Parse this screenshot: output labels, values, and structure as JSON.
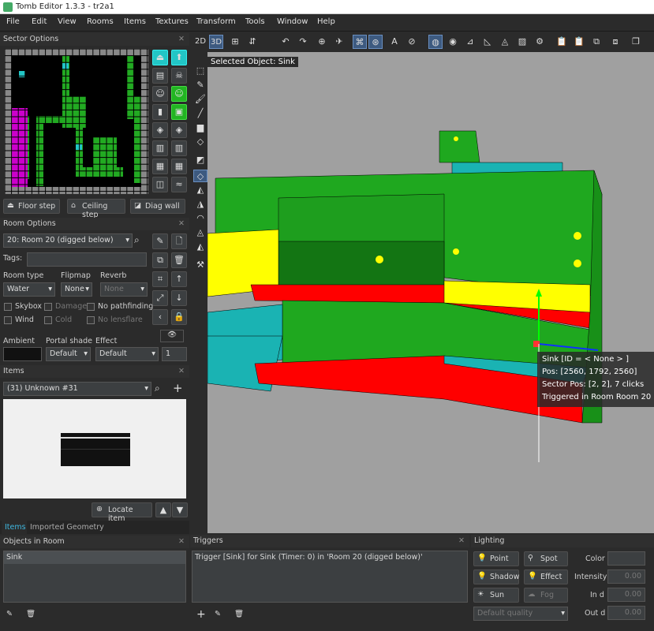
{
  "window": {
    "title": "Tomb Editor 1.3.3 - tr2a1"
  },
  "menu": [
    "File",
    "Edit",
    "View",
    "Rooms",
    "Items",
    "Textures",
    "Transform",
    "Tools",
    "Window",
    "Help"
  ],
  "sector": {
    "title": "Sector Options",
    "floor_step": "Floor step",
    "ceiling_step": "Ceiling step",
    "diag_wall": "Diag wall"
  },
  "room": {
    "title": "Room Options",
    "selected": "20: Room 20 (digged below)",
    "tags_label": "Tags:",
    "type_label": "Room type",
    "type_value": "Water",
    "flipmap_label": "Flipmap",
    "flipmap_value": "None",
    "reverb_label": "Reverb",
    "reverb_value": "None",
    "skybox": "Skybox",
    "damage": "Damage",
    "no_pathfinding": "No pathfinding",
    "wind": "Wind",
    "cold": "Cold",
    "no_lensflare": "No lensflare",
    "ambient_label": "Ambient",
    "portal_shade_label": "Portal shade",
    "portal_shade_value": "Default",
    "effect_label": "Effect",
    "effect_value": "Default",
    "effect_num": "1"
  },
  "items": {
    "title": "Items",
    "selected": "(31) Unknown #31",
    "locate": "Locate item",
    "tab_items": "Items",
    "tab_geometry": "Imported Geometry"
  },
  "objects": {
    "title": "Objects in Room",
    "list": [
      "Sink"
    ]
  },
  "triggers": {
    "title": "Triggers",
    "list": [
      "Trigger [Sink] for Sink (Timer: 0) in 'Room 20 (digged below)'"
    ]
  },
  "lighting": {
    "title": "Lighting",
    "point": "Point",
    "spot": "Spot",
    "shadow": "Shadow",
    "effect": "Effect",
    "sun": "Sun",
    "fog": "Fog",
    "color_label": "Color",
    "intensity_label": "Intensity",
    "intensity_value": "0.00",
    "in_label": "In d",
    "in_value": "0.00",
    "out_label": "Out d",
    "out_value": "0.00",
    "quality": "Default quality"
  },
  "viewport": {
    "mode_2d": "2D",
    "mode_3d": "3D",
    "selected_label": "Selected Object: Sink",
    "tip_line1": "Sink [ID = < None > ]",
    "tip_line2": "Pos: [2560, 1792, 2560]",
    "tip_line3": "Sector Pos: [2, 2], 7 clicks",
    "tip_line4": "Triggered in Room Room 20"
  },
  "colors": {
    "green": "#1fa81f",
    "red": "#ff0000",
    "yellow": "#ffff00",
    "cyan": "#1ab3b3",
    "magenta": "#cc00cc",
    "bg": "#a0a0a0"
  }
}
